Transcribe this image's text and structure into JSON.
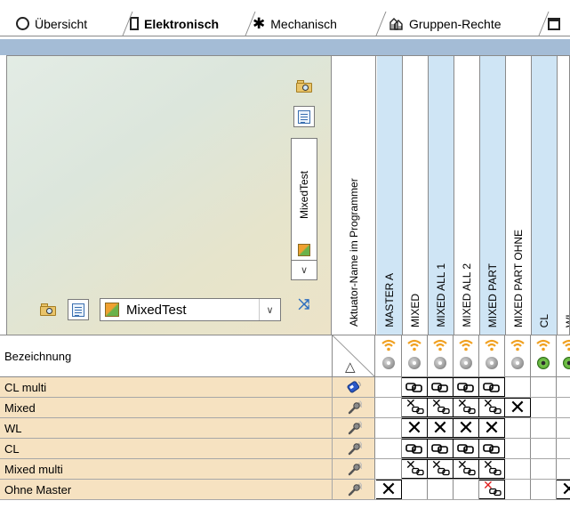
{
  "tabs": [
    {
      "label": "Übersicht",
      "icon": "circle-icon",
      "active": false
    },
    {
      "label": "Elektronisch",
      "icon": "rectangle-icon",
      "active": true
    },
    {
      "label": "Mechanisch",
      "icon": "asterisk-icon",
      "active": false
    },
    {
      "label": "Gruppen-Rechte",
      "icon": "group-icon",
      "active": false
    }
  ],
  "toolbar": {
    "selected_programmer": "MixedTest",
    "vertical_selection": "MixedTest"
  },
  "name_column_header": "Aktuator-Name im Programmer",
  "columns": [
    {
      "label": "MASTER A",
      "status": "grey"
    },
    {
      "label": "MIXED",
      "status": "grey"
    },
    {
      "label": "MIXED ALL 1",
      "status": "grey"
    },
    {
      "label": "MIXED ALL 2",
      "status": "grey"
    },
    {
      "label": "MIXED PART",
      "status": "grey"
    },
    {
      "label": "MIXED PART OHNE",
      "status": "grey"
    },
    {
      "label": "CL",
      "status": "green"
    },
    {
      "label": "WL",
      "status": "green"
    }
  ],
  "grid_header": {
    "label": "Bezeichnung"
  },
  "rows": [
    {
      "label": "CL multi",
      "type_icon": "card-icon",
      "cells": [
        "",
        "chain",
        "chain",
        "chain",
        "chain",
        "",
        "",
        ""
      ]
    },
    {
      "label": "Mixed",
      "type_icon": "key-icon",
      "cells": [
        "",
        "xchain",
        "xchain",
        "xchain",
        "xchain",
        "x",
        "",
        ""
      ]
    },
    {
      "label": "WL",
      "type_icon": "key-icon",
      "cells": [
        "",
        "x",
        "x",
        "x",
        "x",
        "",
        "",
        ""
      ]
    },
    {
      "label": "CL",
      "type_icon": "key-icon",
      "cells": [
        "",
        "chain",
        "chain",
        "chain",
        "chain",
        "",
        "",
        ""
      ]
    },
    {
      "label": "Mixed multi",
      "type_icon": "key-icon",
      "cells": [
        "",
        "xchain",
        "xchain",
        "xchain",
        "xchain",
        "",
        "",
        ""
      ]
    },
    {
      "label": "Ohne Master",
      "type_icon": "key-icon",
      "cells": [
        "x",
        "",
        "",
        "",
        "xchain-red",
        "",
        "",
        "x"
      ]
    }
  ],
  "colors": {
    "row_background": "#f6e2c1",
    "column_highlight": "#cfe5f5",
    "header_strip": "#a4bcd6",
    "status_green": "#4a9a2a",
    "status_grey": "#9a9a9a",
    "mark_red": "#e02020"
  }
}
